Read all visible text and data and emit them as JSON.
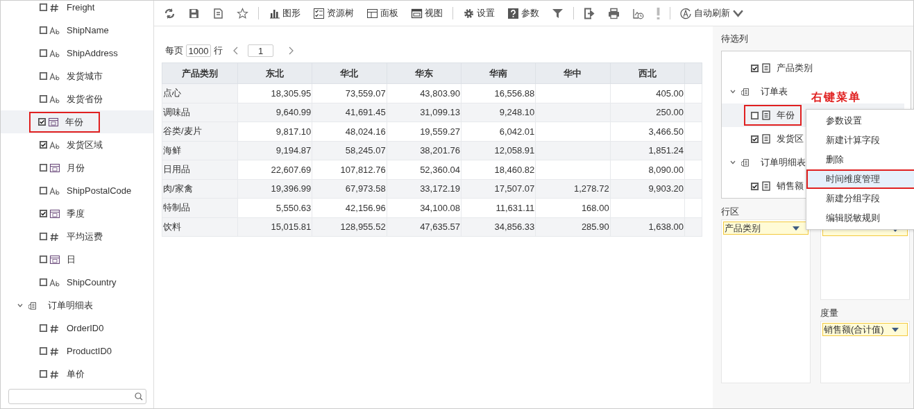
{
  "field_tree": [
    {
      "kind": "number",
      "label": "Freight",
      "checked": false,
      "selected": false,
      "annotated": false
    },
    {
      "kind": "text",
      "label": "ShipName",
      "checked": false,
      "selected": false,
      "annotated": false
    },
    {
      "kind": "text",
      "label": "ShipAddress",
      "checked": false,
      "selected": false,
      "annotated": false
    },
    {
      "kind": "text",
      "label": "发货城市",
      "checked": false,
      "selected": false,
      "annotated": false
    },
    {
      "kind": "text",
      "label": "发货省份",
      "checked": false,
      "selected": false,
      "annotated": false
    },
    {
      "kind": "date",
      "label": "年份",
      "checked": true,
      "selected": true,
      "annotated": true
    },
    {
      "kind": "text",
      "label": "发货区域",
      "checked": true,
      "selected": false,
      "annotated": false
    },
    {
      "kind": "date",
      "label": "月份",
      "checked": false,
      "selected": false,
      "annotated": false
    },
    {
      "kind": "text",
      "label": "ShipPostalCode",
      "checked": false,
      "selected": false,
      "annotated": false
    },
    {
      "kind": "date",
      "label": "季度",
      "checked": true,
      "selected": false,
      "annotated": false
    },
    {
      "kind": "number",
      "label": "平均运费",
      "checked": false,
      "selected": false,
      "annotated": false
    },
    {
      "kind": "date",
      "label": "日",
      "checked": false,
      "selected": false,
      "annotated": false
    },
    {
      "kind": "text",
      "label": "ShipCountry",
      "checked": false,
      "selected": false,
      "annotated": false
    },
    {
      "kind": "table",
      "label": "订单明细表",
      "expanded": true,
      "children": [
        {
          "kind": "number",
          "label": "OrderID0",
          "checked": false,
          "selected": false,
          "annotated": false
        },
        {
          "kind": "number",
          "label": "ProductID0",
          "checked": false,
          "selected": false,
          "annotated": false
        },
        {
          "kind": "number",
          "label": "单价",
          "checked": false,
          "selected": false,
          "annotated": false
        }
      ]
    }
  ],
  "toolbar": [
    {
      "kind": "refresh"
    },
    {
      "kind": "save"
    },
    {
      "kind": "save-as"
    },
    {
      "kind": "star"
    },
    {
      "kind": "sep"
    },
    {
      "kind": "chart",
      "label": "图形"
    },
    {
      "kind": "tree",
      "label": "资源树"
    },
    {
      "kind": "panel",
      "label": "面板"
    },
    {
      "kind": "view",
      "label": "视图"
    },
    {
      "kind": "sep"
    },
    {
      "kind": "gear",
      "label": "设置"
    },
    {
      "kind": "help",
      "label": "参数"
    },
    {
      "kind": "filter"
    },
    {
      "kind": "sep"
    },
    {
      "kind": "export"
    },
    {
      "kind": "print"
    },
    {
      "kind": "schedule"
    },
    {
      "kind": "alert"
    },
    {
      "kind": "sep"
    },
    {
      "kind": "auto",
      "label": "自动刷新"
    }
  ],
  "pager": {
    "per_page_label": "每页",
    "per_page": "1000",
    "rows_label": "行",
    "page": "1"
  },
  "table": {
    "columns": [
      "产品类别",
      "东北",
      "华北",
      "华东",
      "华南",
      "华中",
      "西北",
      ""
    ],
    "rows": [
      [
        "点心",
        "18,305.95",
        "73,559.07",
        "43,803.90",
        "16,556.88",
        "",
        "405.00"
      ],
      [
        "调味品",
        "9,640.99",
        "41,691.45",
        "31,099.13",
        "9,248.10",
        "",
        "250.00"
      ],
      [
        "谷类/麦片",
        "9,817.10",
        "48,024.16",
        "19,559.27",
        "6,042.01",
        "",
        "3,466.50"
      ],
      [
        "海鲜",
        "9,194.87",
        "58,245.07",
        "38,201.76",
        "12,058.91",
        "",
        "1,851.24"
      ],
      [
        "日用品",
        "22,607.69",
        "107,812.76",
        "52,360.04",
        "18,460.82",
        "",
        "8,090.00"
      ],
      [
        "肉/家禽",
        "19,396.99",
        "67,973.58",
        "33,172.19",
        "17,507.07",
        "1,278.72",
        "9,903.20"
      ],
      [
        "特制品",
        "5,550.63",
        "42,156.96",
        "34,100.08",
        "11,631.11",
        "168.00",
        ""
      ],
      [
        "饮料",
        "15,015.81",
        "128,955.52",
        "47,635.57",
        "34,856.33",
        "285.90",
        "1,638.00"
      ]
    ]
  },
  "candidate_columns": {
    "title": "待选列",
    "items": [
      {
        "kind": "field",
        "label": "产品类别",
        "checked": true,
        "selected": false,
        "annotated": false
      },
      {
        "kind": "table",
        "label": "订单表",
        "expanded": true
      },
      {
        "kind": "field",
        "label": "年份",
        "checked": false,
        "selected": true,
        "annotated": true
      },
      {
        "kind": "field",
        "label": "发货区",
        "checked": true,
        "selected": false,
        "annotated": false
      },
      {
        "kind": "table",
        "label": "订单明细表",
        "expanded": true
      },
      {
        "kind": "field",
        "label": "销售额",
        "checked": true,
        "selected": false,
        "annotated": false
      }
    ]
  },
  "annotation": "右键菜单",
  "context_menu": [
    {
      "label": "参数设置",
      "selected": false
    },
    {
      "label": "新建计算字段",
      "selected": false
    },
    {
      "label": "删除",
      "selected": false
    },
    {
      "label": "时间维度管理",
      "selected": true
    },
    {
      "label": "新建分组字段",
      "selected": false
    },
    {
      "label": "编辑脱敏规则",
      "selected": false
    }
  ],
  "row_area": {
    "title": "行区",
    "chips": [
      "产品类别"
    ]
  },
  "measure_area": {
    "title": "度量",
    "chips": [
      "销售额(合计值)"
    ]
  }
}
